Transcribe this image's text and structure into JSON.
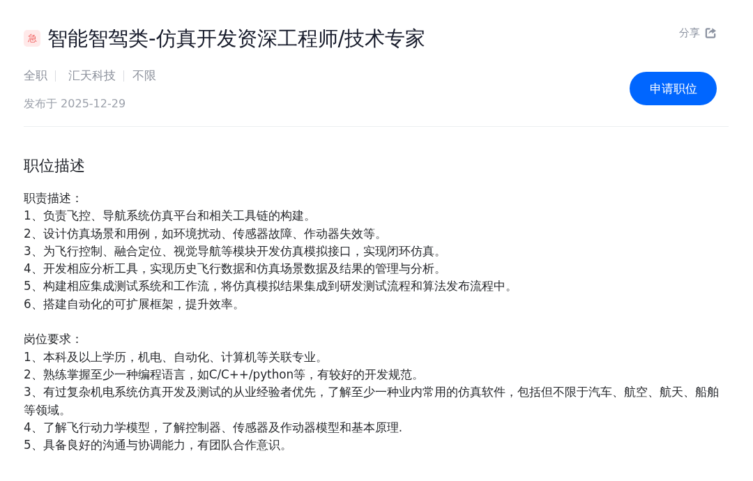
{
  "job": {
    "urgent_badge": "急",
    "title": "智能智驾类-仿真开发资深工程师/技术专家",
    "share": {
      "label": "分享"
    },
    "meta": [
      "全职",
      "汇天科技",
      "不限"
    ],
    "published": "发布于 2025-12-29",
    "apply_button": "申请职位"
  },
  "description": {
    "heading": "职位描述",
    "sections": [
      {
        "heading": "职责描述：",
        "lines": [
          "1、负责飞控、导航系统仿真平台和相关工具链的构建。",
          "2、设计仿真场景和用例，如环境扰动、传感器故障、作动器失效等。",
          "3、为飞行控制、融合定位、视觉导航等模块开发仿真模拟接口，实现闭环仿真。",
          "4、开发相应分析工具，实现历史飞行数据和仿真场景数据及结果的管理与分析。",
          "5、构建相应集成测试系统和工作流，将仿真模拟结果集成到研发测试流程和算法发布流程中。",
          "6、搭建自动化的可扩展框架，提升效率。"
        ]
      },
      {
        "heading": "岗位要求：",
        "lines": [
          "1、本科及以上学历，机电、自动化、计算机等关联专业。",
          "2、熟练掌握至少一种编程语言，如C/C++/python等，有较好的开发规范。",
          "3、有过复杂机电系统仿真开发及测试的从业经验者优先，了解至少一种业内常用的仿真软件，包括但不限于汽车、航空、航天、船舶等领域。",
          "4、了解飞行动力学模型，了解控制器、传感器及作动器模型和基本原理.",
          "5、具备良好的沟通与协调能力，有团队合作意识。"
        ]
      }
    ]
  }
}
